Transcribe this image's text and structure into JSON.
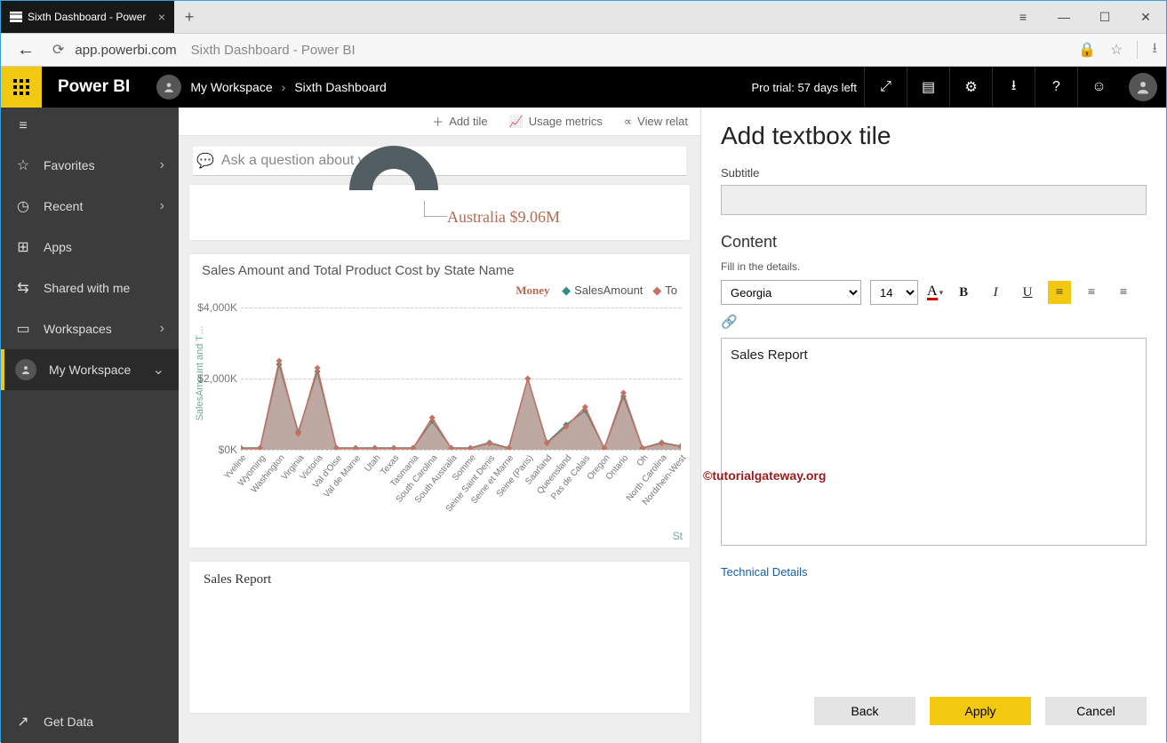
{
  "browser": {
    "tab_title": "Sixth Dashboard - Power",
    "url_host": "app.powerbi.com",
    "url_title": "Sixth Dashboard - Power BI"
  },
  "appbar": {
    "brand": "Power BI",
    "workspace": "My Workspace",
    "dashboard": "Sixth Dashboard",
    "trial": "Pro trial: 57 days left"
  },
  "leftnav": {
    "favorites": "Favorites",
    "recent": "Recent",
    "apps": "Apps",
    "shared": "Shared with me",
    "workspaces": "Workspaces",
    "myworkspace": "My Workspace",
    "getdata": "Get Data"
  },
  "toolbar": {
    "add_tile": "Add tile",
    "usage": "Usage metrics",
    "related": "View relat"
  },
  "qa_placeholder": "Ask a question about your data",
  "tile_aus": "Australia $9.06M",
  "chart_title": "Sales Amount and Total Product Cost by State Name",
  "legend": {
    "money": "Money",
    "s1": "SalesAmount",
    "s2": "To"
  },
  "yaxis_title": "SalesAmount and T…",
  "xfoot": "St",
  "report_tile_text": "Sales Report",
  "panel": {
    "title": "Add textbox tile",
    "subtitle_label": "Subtitle",
    "content_label": "Content",
    "hint": "Fill in the details.",
    "font": "Georgia",
    "size": "14",
    "editor_text": "Sales Report",
    "tech": "Technical Details",
    "back": "Back",
    "apply": "Apply",
    "cancel": "Cancel"
  },
  "watermark": "©tutorialgateway.org",
  "chart_data": {
    "type": "area",
    "title": "Sales Amount and Total Product Cost by State Name",
    "ylabel": "SalesAmount and T…",
    "ylim": [
      0,
      4000
    ],
    "yticks": [
      "$0K",
      "$2,000K",
      "$4,000K"
    ],
    "categories": [
      "Yveline",
      "Wyoming",
      "Washington",
      "Virginia",
      "Victoria",
      "Val d'Oise",
      "Val de Marne",
      "Utah",
      "Texas",
      "Tasmania",
      "South Carolina",
      "South Australia",
      "Somme",
      "Seine Saint Denis",
      "Seine et Marne",
      "Seine (Paris)",
      "Saarland",
      "Queensland",
      "Pas de Calais",
      "Oregon",
      "Ontario",
      "Oh",
      "North Carolina",
      "Nordrhein-West"
    ],
    "series": [
      {
        "name": "SalesAmount",
        "color": "#2b8f86",
        "values": [
          50,
          50,
          2400,
          500,
          2200,
          50,
          50,
          50,
          50,
          50,
          800,
          50,
          50,
          200,
          50,
          2000,
          200,
          700,
          1100,
          50,
          1500,
          50,
          200,
          100
        ]
      },
      {
        "name": "TotalProductCost",
        "color": "#c97063",
        "values": [
          40,
          40,
          2500,
          450,
          2300,
          40,
          40,
          40,
          40,
          40,
          900,
          40,
          40,
          180,
          40,
          2000,
          180,
          650,
          1200,
          40,
          1600,
          40,
          180,
          90
        ]
      }
    ]
  }
}
